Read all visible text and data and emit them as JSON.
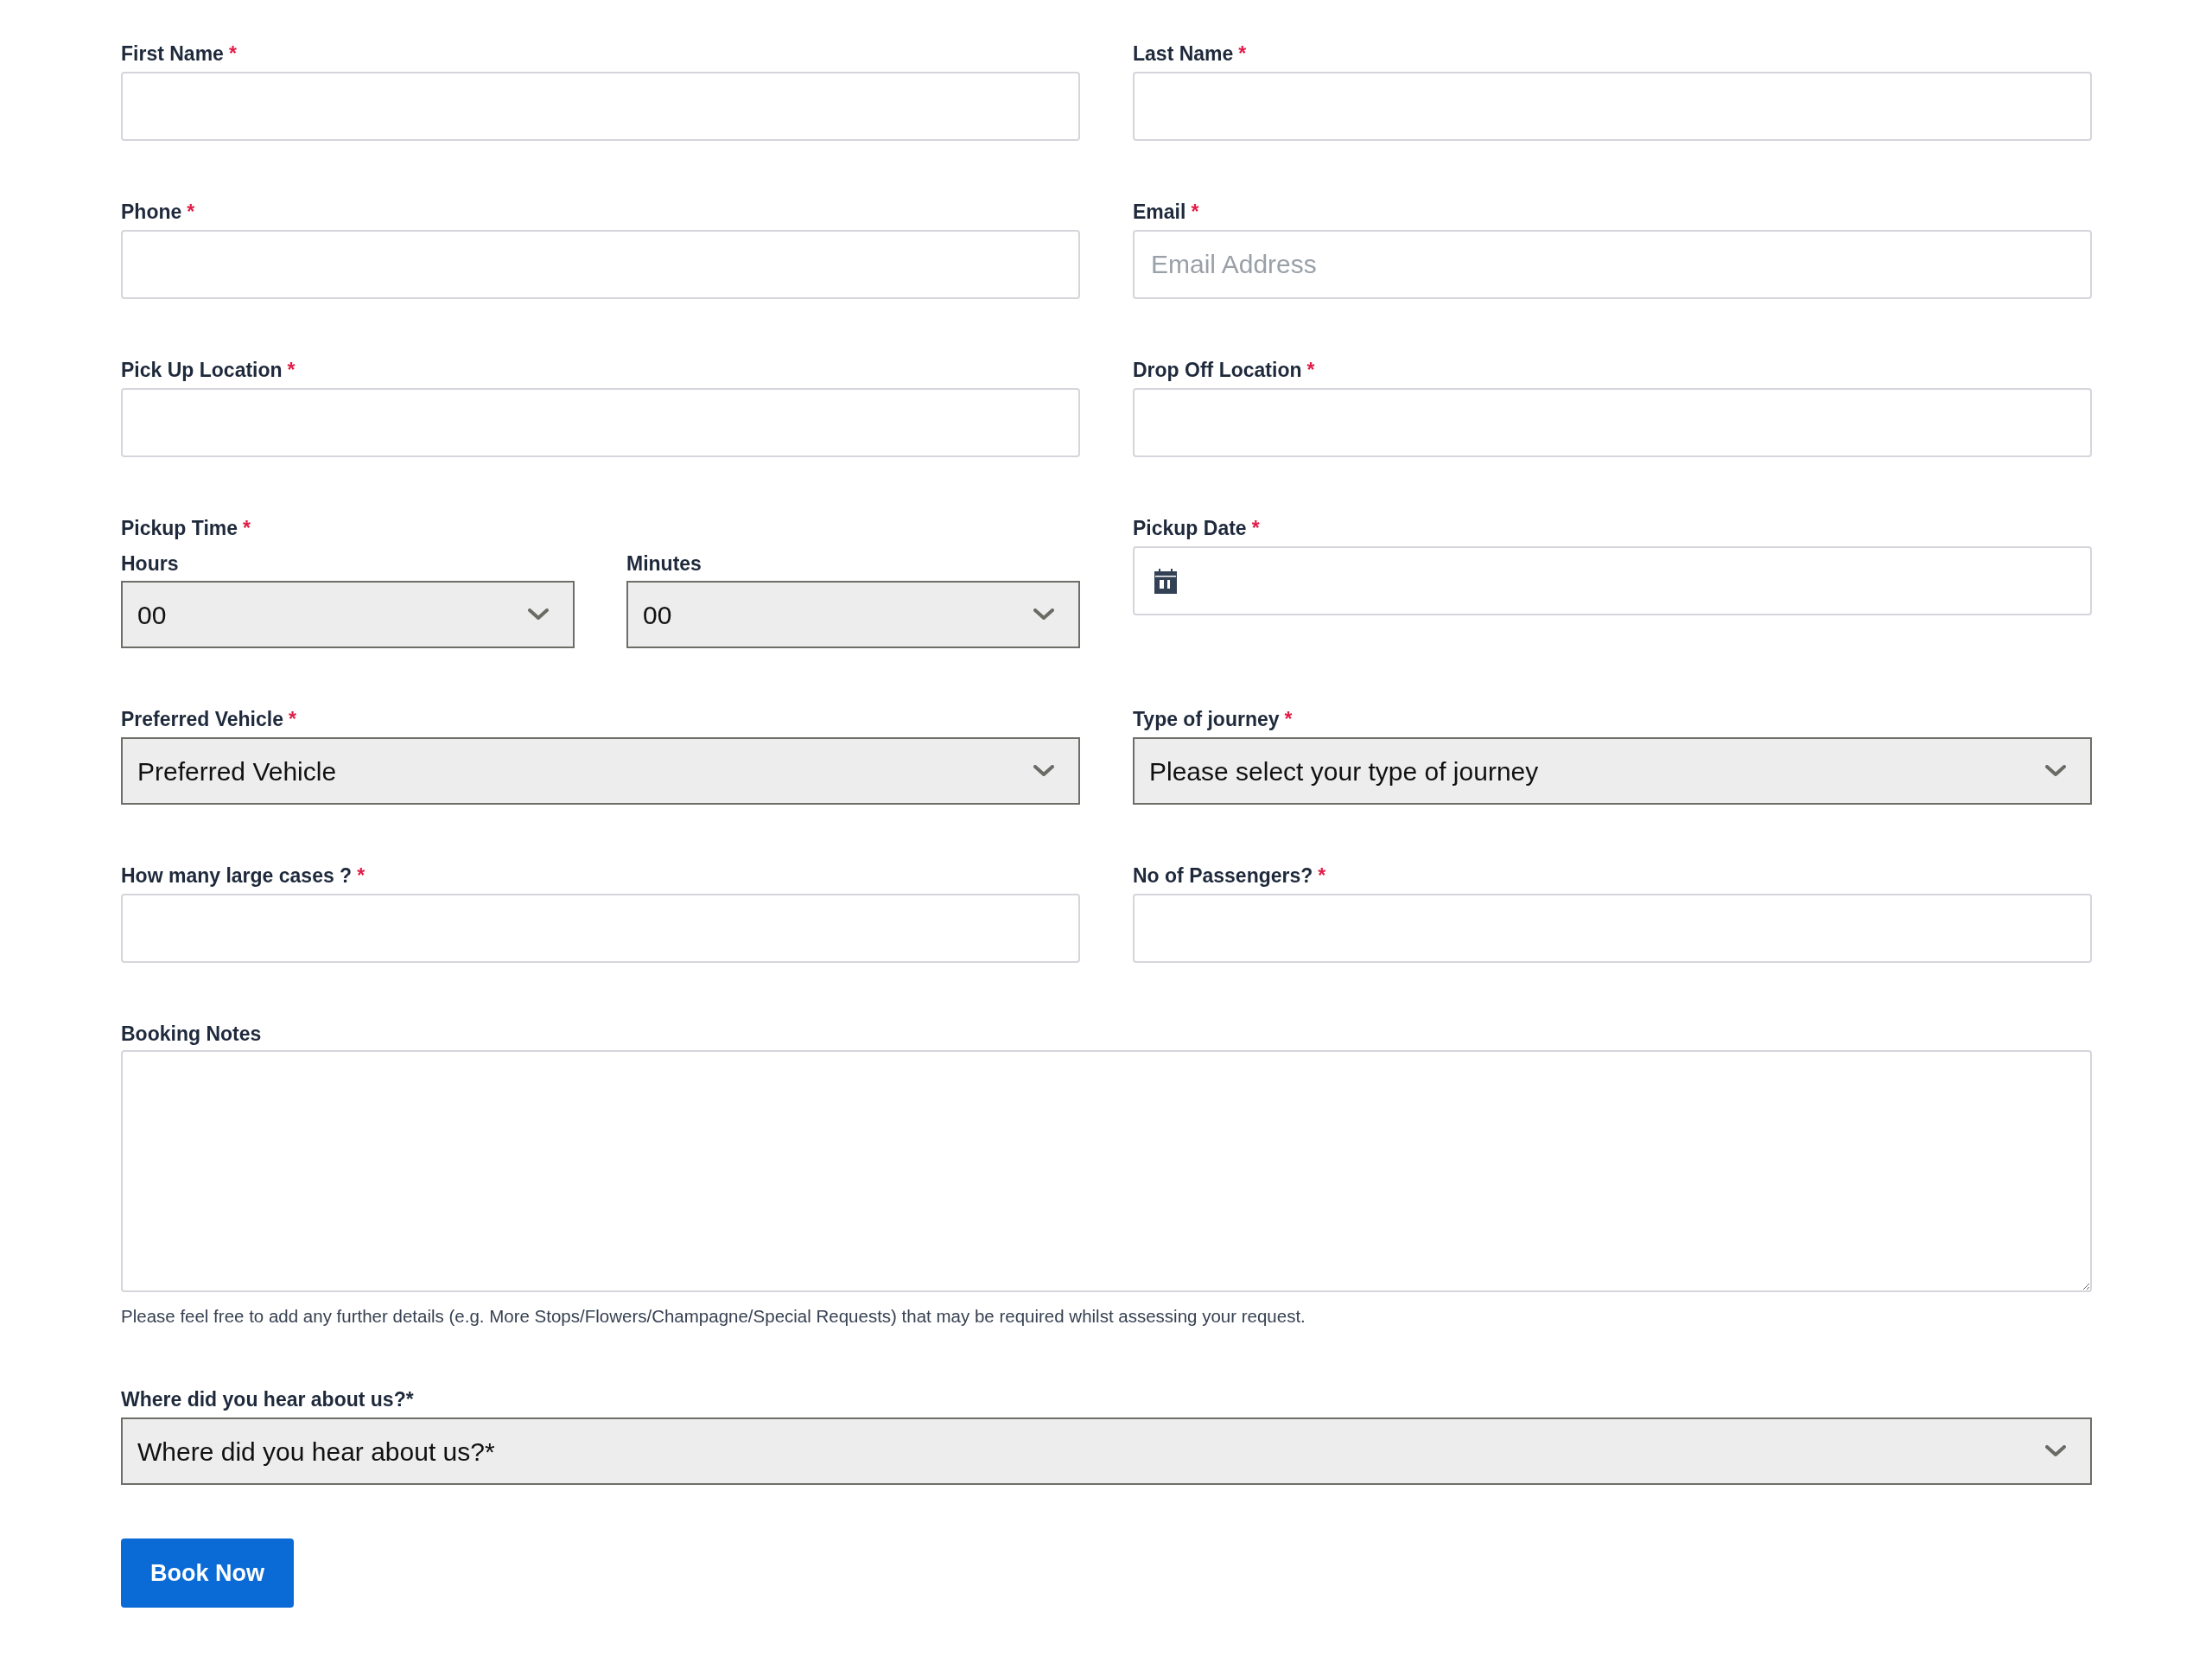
{
  "rows": [
    {
      "fields": [
        {
          "kind": "text",
          "label": "First Name",
          "required_mark": "*"
        },
        {
          "kind": "text",
          "label": "Last Name",
          "required_mark": "*"
        }
      ]
    },
    {
      "fields": [
        {
          "kind": "text",
          "label": "Phone",
          "required_mark": "*"
        },
        {
          "kind": "text",
          "label": "Email",
          "required_mark": "*",
          "placeholder": "Email Address"
        }
      ]
    },
    {
      "fields": [
        {
          "kind": "text",
          "label": "Pick Up Location",
          "required_mark": "*"
        },
        {
          "kind": "text",
          "label": "Drop Off Location",
          "required_mark": "*"
        }
      ]
    },
    {
      "fields": [
        {
          "kind": "time",
          "label": "Pickup Time",
          "required_mark": "*",
          "parts": [
            {
              "label": "Hours",
              "value": "00"
            },
            {
              "label": "Minutes",
              "value": "00"
            }
          ]
        },
        {
          "kind": "date",
          "label": "Pickup Date",
          "required_mark": "*"
        }
      ]
    },
    {
      "fields": [
        {
          "kind": "select",
          "label": "Preferred Vehicle",
          "required_mark": "*",
          "value": "Preferred Vehicle"
        },
        {
          "kind": "select",
          "label": "Type of journey",
          "required_mark": "*",
          "value": "Please select your type of journey"
        }
      ]
    },
    {
      "fields": [
        {
          "kind": "text",
          "label": "How many large cases ?",
          "required_mark": "*"
        },
        {
          "kind": "text",
          "label": "No of Passengers?",
          "required_mark": "*"
        }
      ]
    },
    {
      "fields": [
        {
          "kind": "textarea",
          "label": "Booking Notes",
          "hint": "Please feel free to add any further details (e.g. More Stops/Flowers/Champagne/Special Requests) that may be required whilst assessing your request."
        }
      ]
    },
    {
      "fields": [
        {
          "kind": "select",
          "label": "Where did you hear about us?*",
          "value": "Where did you hear about us?*"
        }
      ]
    }
  ],
  "submit_button": {
    "label": "Book Now"
  }
}
